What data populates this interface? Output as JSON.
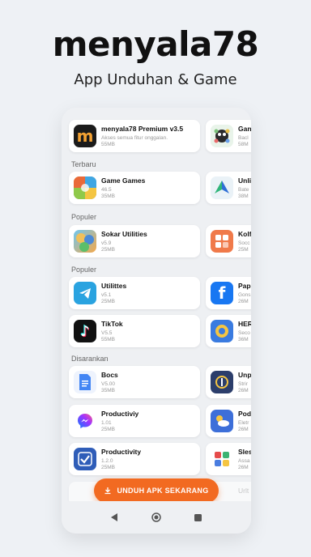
{
  "hero": {
    "title": "menyala78",
    "subtitle": "App Unduhan & Game"
  },
  "featured": {
    "name": "menyala78 Premium v3.5",
    "meta": "Akses semua fitur onggalan.",
    "size": "55MB",
    "right": {
      "name": "Gan",
      "meta": "Bacl",
      "size": "58M"
    }
  },
  "sections": [
    {
      "label": "Terbaru"
    },
    {
      "label": "Populer"
    },
    {
      "label": "Populer"
    },
    {
      "label": "Disarankan"
    }
  ],
  "apps": [
    {
      "name": "Game Games",
      "version": "46.5",
      "size": "35MB",
      "right_name": "Unli",
      "right_meta": "Bate",
      "right_size": "38M"
    },
    {
      "name": "Sokar Utilities",
      "version": "v5.9",
      "size": "25MB",
      "right_name": "Kolf",
      "right_meta": "Socc",
      "right_size": "25M"
    },
    {
      "name": "Utilittes",
      "version": "v5.1",
      "size": "25MB",
      "right_name": "Pap",
      "right_meta": "Gons",
      "right_size": "26M"
    },
    {
      "name": "TikTok",
      "version": "V5.5",
      "size": "55MB",
      "right_name": "HER",
      "right_meta": "Seco",
      "right_size": "36M"
    },
    {
      "name": "Bocs",
      "version": "V5.00",
      "size": "35MB",
      "right_name": "Unp",
      "right_meta": "Strir",
      "right_size": "26M"
    },
    {
      "name": "Productiviy",
      "version": "1.01",
      "size": "25MB",
      "right_name": "Pod",
      "right_meta": "Eletr",
      "right_size": "26M"
    },
    {
      "name": "Productivity",
      "version": "1.2.0",
      "size": "25MB",
      "right_name": "Sles",
      "right_meta": "Assa",
      "right_size": "26M"
    }
  ],
  "bottom_partial": {
    "right_name": "Urlt"
  },
  "cta": {
    "label": "UNDUH APK SEKARANG",
    "color": "#f26a21"
  },
  "icons": {
    "back": "back-triangle-icon",
    "home": "home-circle-icon",
    "recents": "recents-square-icon",
    "download": "download-icon"
  }
}
